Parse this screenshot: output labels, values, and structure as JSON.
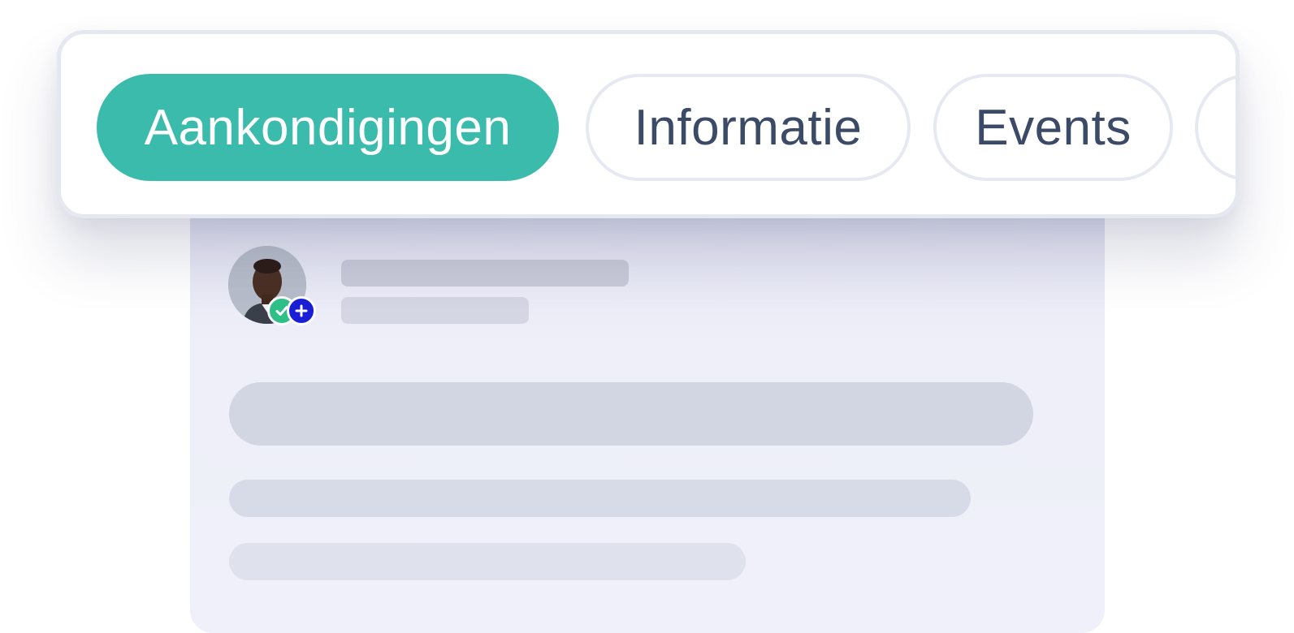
{
  "tabs": [
    {
      "label": "Aankondigingen",
      "active": true
    },
    {
      "label": "Informatie",
      "active": false
    },
    {
      "label": "Events",
      "active": false
    },
    {
      "label": "",
      "active": false
    }
  ],
  "colors": {
    "accent": "#3bbbab",
    "inactive_text": "#3b4a66",
    "tab_border": "#e7e9f2",
    "badge_check": "#2fc089",
    "badge_plus": "#1a1fd6"
  },
  "post": {
    "avatar_icon": "user-avatar",
    "badges": [
      "check-icon",
      "plus-icon"
    ]
  }
}
